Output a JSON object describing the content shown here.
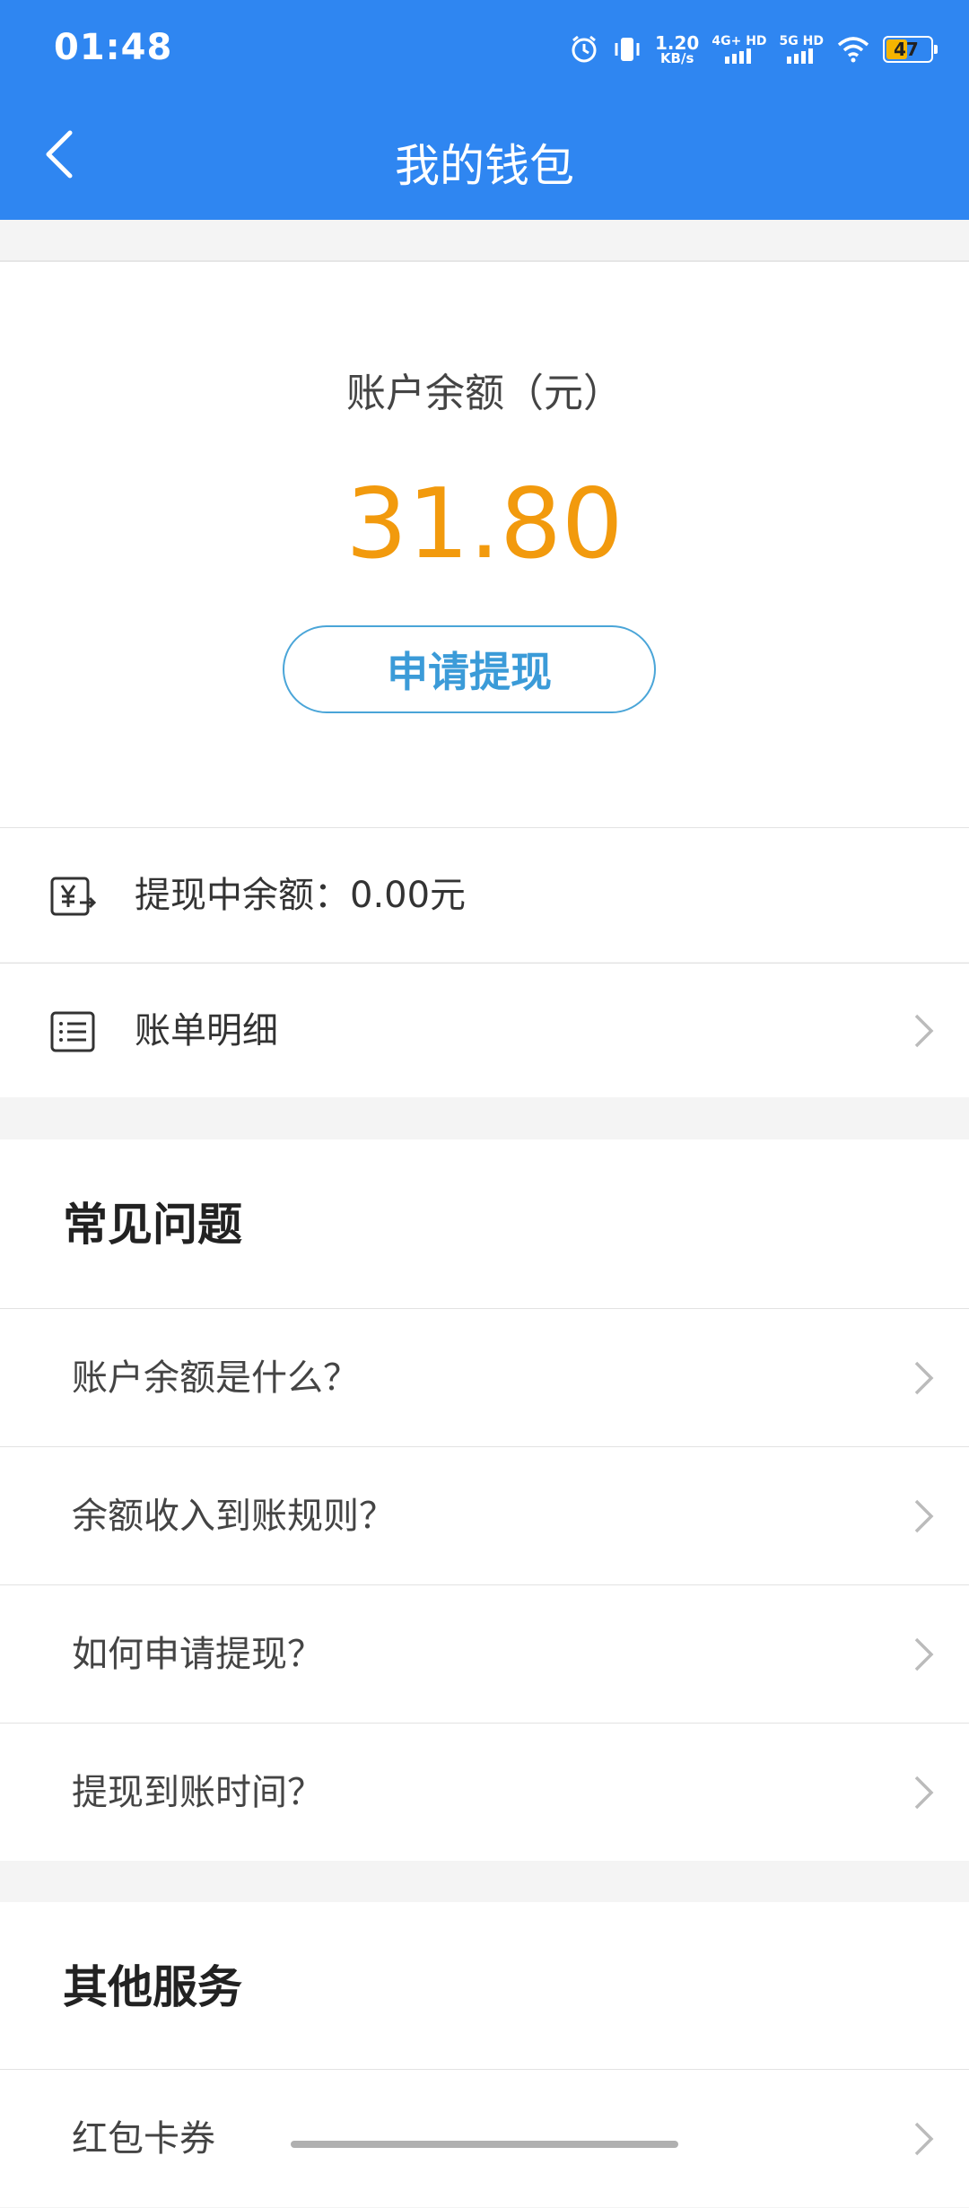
{
  "status_bar": {
    "time": "01:48",
    "speed_value": "1.20",
    "speed_unit": "KB/s",
    "sim1": "4G+ HD",
    "sim2": "5G HD",
    "battery": "47"
  },
  "header": {
    "title": "我的钱包"
  },
  "balance": {
    "label": "账户余额（元）",
    "amount": "31.80",
    "withdraw_button": "申请提现"
  },
  "rows": [
    {
      "icon": "yuan-transfer-icon",
      "label": "提现中余额：0.00元"
    },
    {
      "icon": "bill-list-icon",
      "label": "账单明细"
    }
  ],
  "faq": {
    "title": "常见问题",
    "items": [
      "账户余额是什么？",
      "余额收入到账规则？",
      "如何申请提现？",
      "提现到账时间？"
    ]
  },
  "other": {
    "title": "其他服务",
    "items": [
      "红包卡券"
    ]
  },
  "colors": {
    "header": "#2f86f1",
    "amount": "#f29a0d",
    "button": "#3b9bd8"
  }
}
